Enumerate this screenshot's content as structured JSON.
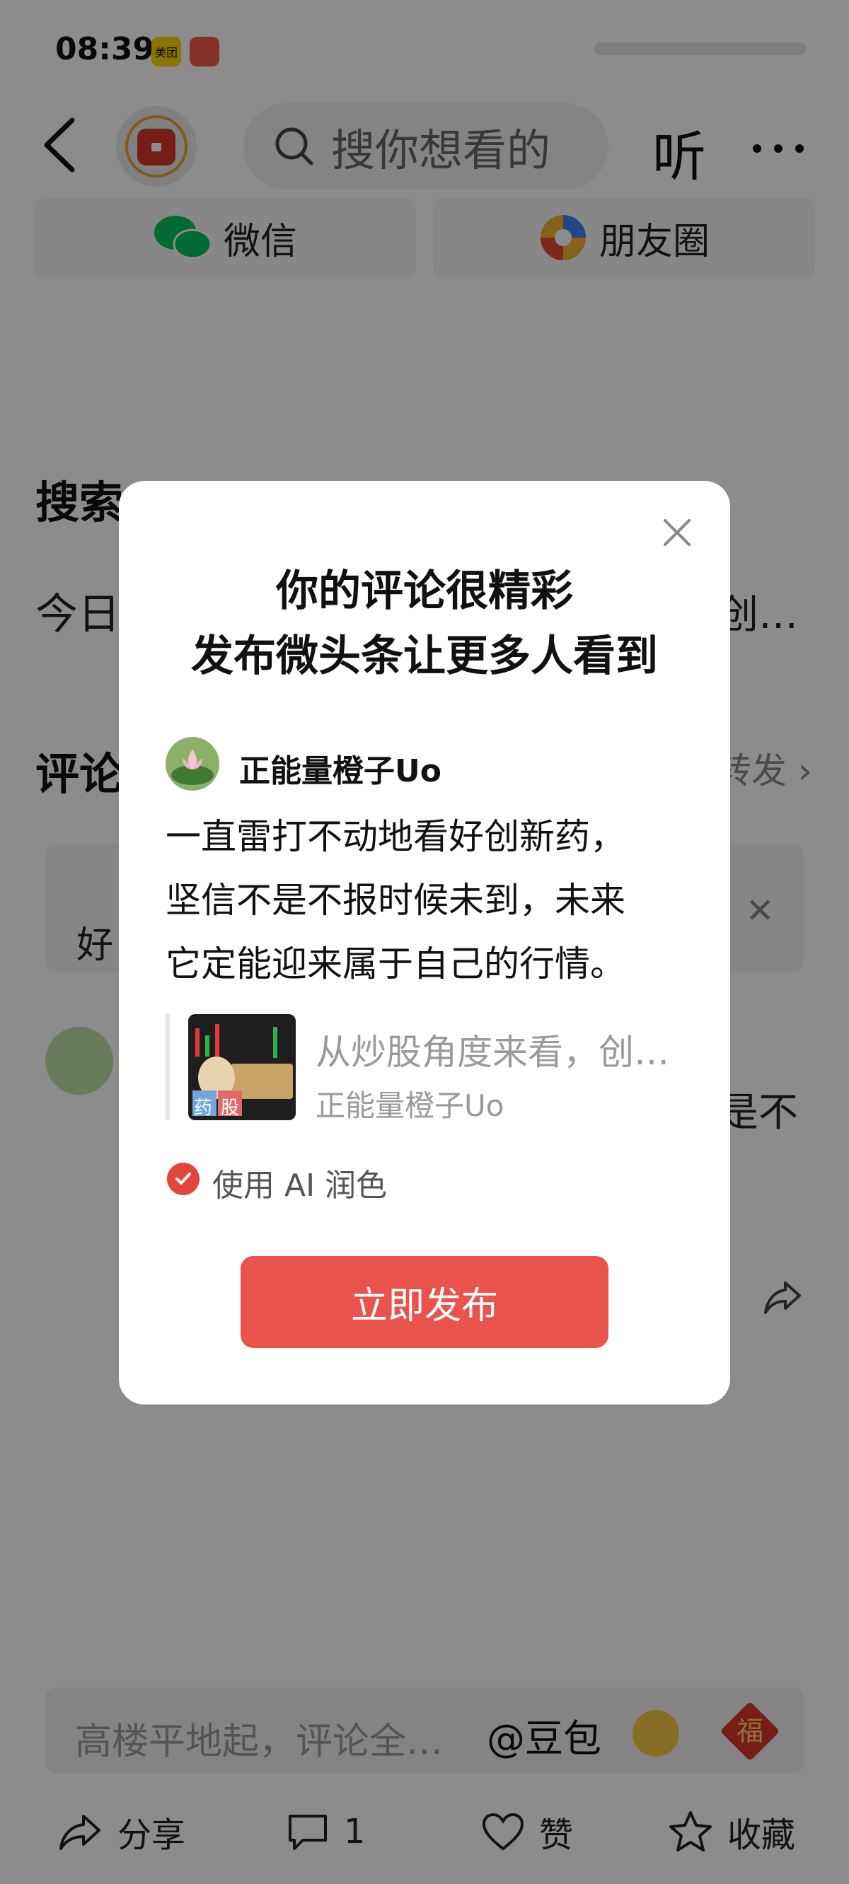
{
  "status_bar": {
    "time": "08:39",
    "app_badges": [
      {
        "icon": "meituan-badge-icon",
        "label": "美团"
      },
      {
        "icon": "mascot-badge-icon",
        "label": ""
      }
    ]
  },
  "nav": {
    "search_placeholder": "搜你想看的",
    "listen_label": "听"
  },
  "share_row": {
    "wechat_label": "微信",
    "moments_label": "朋友圈"
  },
  "background": {
    "search_section_title": "搜索",
    "today_prefix": "今日",
    "tail_text": "创…",
    "comments_section_title": "评论",
    "forward_label": "转发",
    "topic_text": "好",
    "tail_text_2": "是不"
  },
  "dialog": {
    "title_line1": "你的评论很精彩",
    "title_line2": "发布微头条让更多人看到",
    "username": "正能量橙子Uo",
    "body_line1": "一直雷打不动地看好创新药，",
    "body_line2": "坚信不是不报时候未到，未来",
    "body_line3": "它定能迎来属于自己的行情。",
    "quote": {
      "title": "从炒股角度来看，创…",
      "author": "正能量橙子Uo",
      "thumb_tags": [
        "药",
        "股"
      ]
    },
    "ai_option_label": "使用 AI 润色",
    "ai_option_checked": true,
    "publish_label": "立即发布"
  },
  "comment_bar": {
    "placeholder": "高楼平地起，评论全…",
    "mention": "@豆包",
    "fu_label": "福"
  },
  "bottom_actions": {
    "share_label": "分享",
    "comment_count": "1",
    "like_label": "赞",
    "favorite_label": "收藏"
  },
  "colors": {
    "accent_red": "#ea534b",
    "overlay": "rgba(0,0,0,0.45)"
  }
}
